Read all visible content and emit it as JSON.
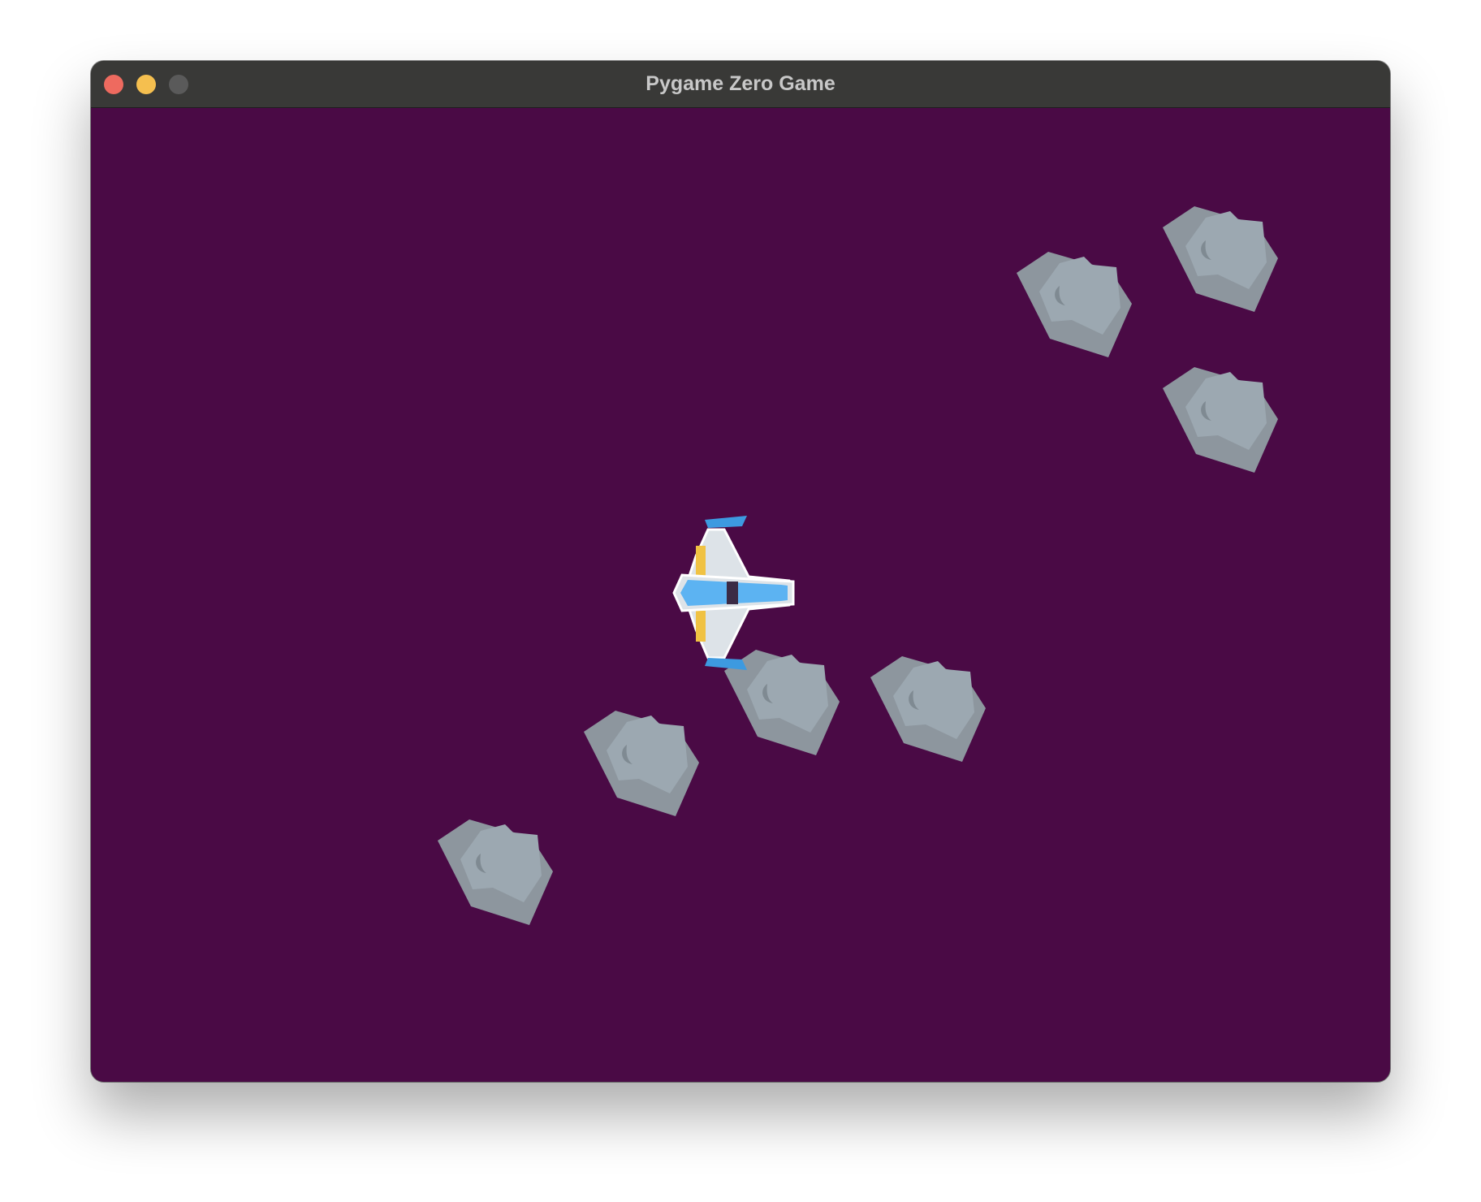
{
  "window": {
    "title": "Pygame Zero Game",
    "buttons": [
      {
        "name": "close",
        "color": "#ee6a5f"
      },
      {
        "name": "minimize",
        "color": "#f5bf4f"
      },
      {
        "name": "maximize",
        "color": "#5a5a5a"
      }
    ]
  },
  "game": {
    "background_color": "#4a0a45",
    "player": {
      "sprite": "spaceship",
      "colors": {
        "body": "#dde3e8",
        "canopy": "#5cb3f2",
        "thruster": "#f0c243",
        "wingtip": "#3d9ae0"
      }
    },
    "asteroid_count": 7,
    "asteroid_colors": {
      "outer": "#8d969e",
      "inner": "#9ca8b1",
      "crater": "#7f8a92"
    }
  }
}
